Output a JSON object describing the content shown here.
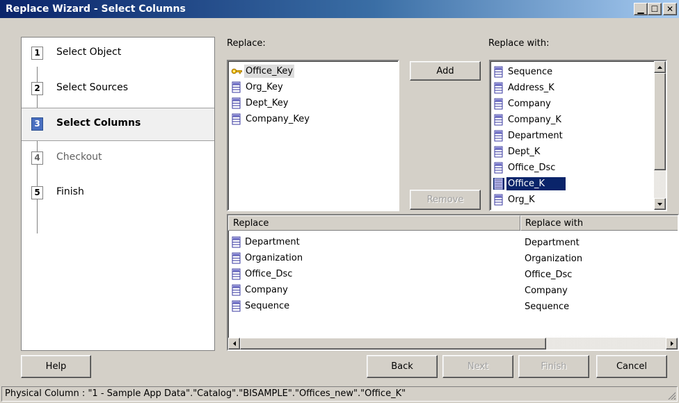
{
  "window": {
    "title": "Replace Wizard - Select Columns",
    "controls": {
      "minimize": "_",
      "maximize": "□",
      "close": "×"
    }
  },
  "steps": [
    {
      "num": "1",
      "label": "Select Object",
      "state": "done"
    },
    {
      "num": "2",
      "label": "Select Sources",
      "state": "done"
    },
    {
      "num": "3",
      "label": "Select Columns",
      "state": "active"
    },
    {
      "num": "4",
      "label": "Checkout",
      "state": "disabled"
    },
    {
      "num": "5",
      "label": "Finish",
      "state": "done"
    }
  ],
  "replace": {
    "label": "Replace:",
    "items": [
      {
        "text": "Office_Key",
        "icon": "key-icon",
        "selected": true
      },
      {
        "text": "Org_Key",
        "icon": "column-icon"
      },
      {
        "text": "Dept_Key",
        "icon": "column-icon"
      },
      {
        "text": "Company_Key",
        "icon": "column-icon"
      }
    ]
  },
  "actions": {
    "add": "Add",
    "remove": "Remove"
  },
  "replace_with": {
    "label": "Replace with:",
    "items": [
      {
        "text": "Sequence",
        "icon": "column-icon"
      },
      {
        "text": "Address_K",
        "icon": "column-icon"
      },
      {
        "text": "Company",
        "icon": "column-icon"
      },
      {
        "text": "Company_K",
        "icon": "column-icon"
      },
      {
        "text": "Department",
        "icon": "column-icon"
      },
      {
        "text": "Dept_K",
        "icon": "column-icon"
      },
      {
        "text": "Office_Dsc",
        "icon": "column-icon"
      },
      {
        "text": "Office_K",
        "icon": "column-icon",
        "selected": true
      },
      {
        "text": "Org_K",
        "icon": "column-icon"
      }
    ]
  },
  "mapping": {
    "columns": [
      "Replace",
      "Replace with"
    ],
    "rows": [
      {
        "replace": "Department",
        "replace_with": "Department"
      },
      {
        "replace": "Organization",
        "replace_with": "Organization"
      },
      {
        "replace": "Office_Dsc",
        "replace_with": "Office_Dsc"
      },
      {
        "replace": "Company",
        "replace_with": "Company"
      },
      {
        "replace": "Sequence",
        "replace_with": "Sequence"
      }
    ]
  },
  "buttons": {
    "help": "Help",
    "back": "Back",
    "next": "Next",
    "finish": "Finish",
    "cancel": "Cancel"
  },
  "status": "Physical Column : \"1 - Sample App Data\".\"Catalog\".\"BISAMPLE\".\"Offices_new\".\"Office_K\"",
  "colors": {
    "title_start": "#0a246a",
    "title_end": "#a6caf0",
    "selection": "#0a246a",
    "active_step": "#4a6fc0"
  }
}
